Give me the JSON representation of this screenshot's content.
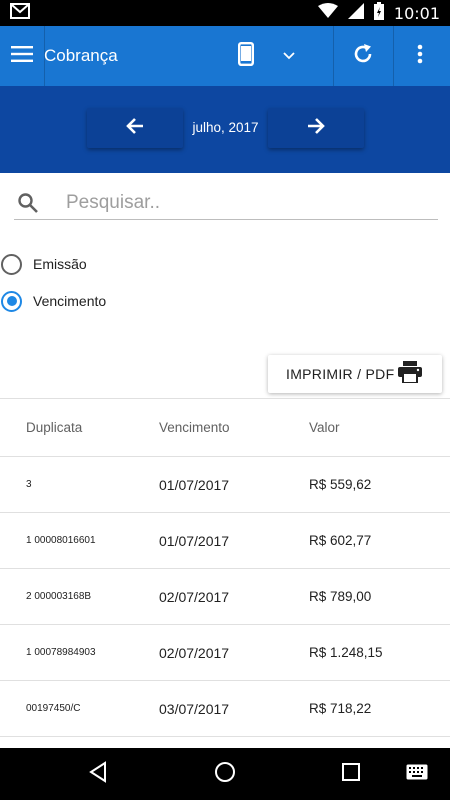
{
  "status_bar": {
    "time": "10:01",
    "icons": [
      "gmail-icon",
      "wifi-icon",
      "signal-icon",
      "battery-charging-icon"
    ]
  },
  "app_bar": {
    "title": "Cobrança",
    "icons": [
      "menu-icon",
      "phone-icon",
      "dropdown-arrow-icon",
      "refresh-icon",
      "more-vert-icon"
    ]
  },
  "date_nav": {
    "label": "julho, 2017",
    "icons": [
      "arrow-left-icon",
      "arrow-right-icon"
    ]
  },
  "search": {
    "value": "",
    "placeholder": "Pesquisar.."
  },
  "filter": {
    "options": [
      {
        "label": "Emissão",
        "checked": false
      },
      {
        "label": "Vencimento",
        "checked": true
      }
    ]
  },
  "print_button": {
    "label": "IMPRIMIR / PDF",
    "icon": "print-icon"
  },
  "table": {
    "columns": [
      "Duplicata",
      "Vencimento",
      "Valor"
    ],
    "rows": [
      {
        "duplicata": "3",
        "vencimento": "01/07/2017",
        "valor": "R$ 559,62"
      },
      {
        "duplicata": "1 00008016601",
        "vencimento": "01/07/2017",
        "valor": "R$ 602,77"
      },
      {
        "duplicata": "2 000003168B",
        "vencimento": "02/07/2017",
        "valor": "R$ 789,00"
      },
      {
        "duplicata": "1 00078984903",
        "vencimento": "02/07/2017",
        "valor": "R$ 1.248,15"
      },
      {
        "duplicata": "00197450/C",
        "vencimento": "03/07/2017",
        "valor": "R$ 718,22"
      }
    ]
  },
  "nav_bar": {
    "icons": [
      "back-icon",
      "home-icon",
      "recents-icon",
      "keyboard-icon"
    ]
  },
  "colors": {
    "app_bar": "#1976d2",
    "date_band": "#0d47a1",
    "radio_accent": "#1e88e5"
  }
}
